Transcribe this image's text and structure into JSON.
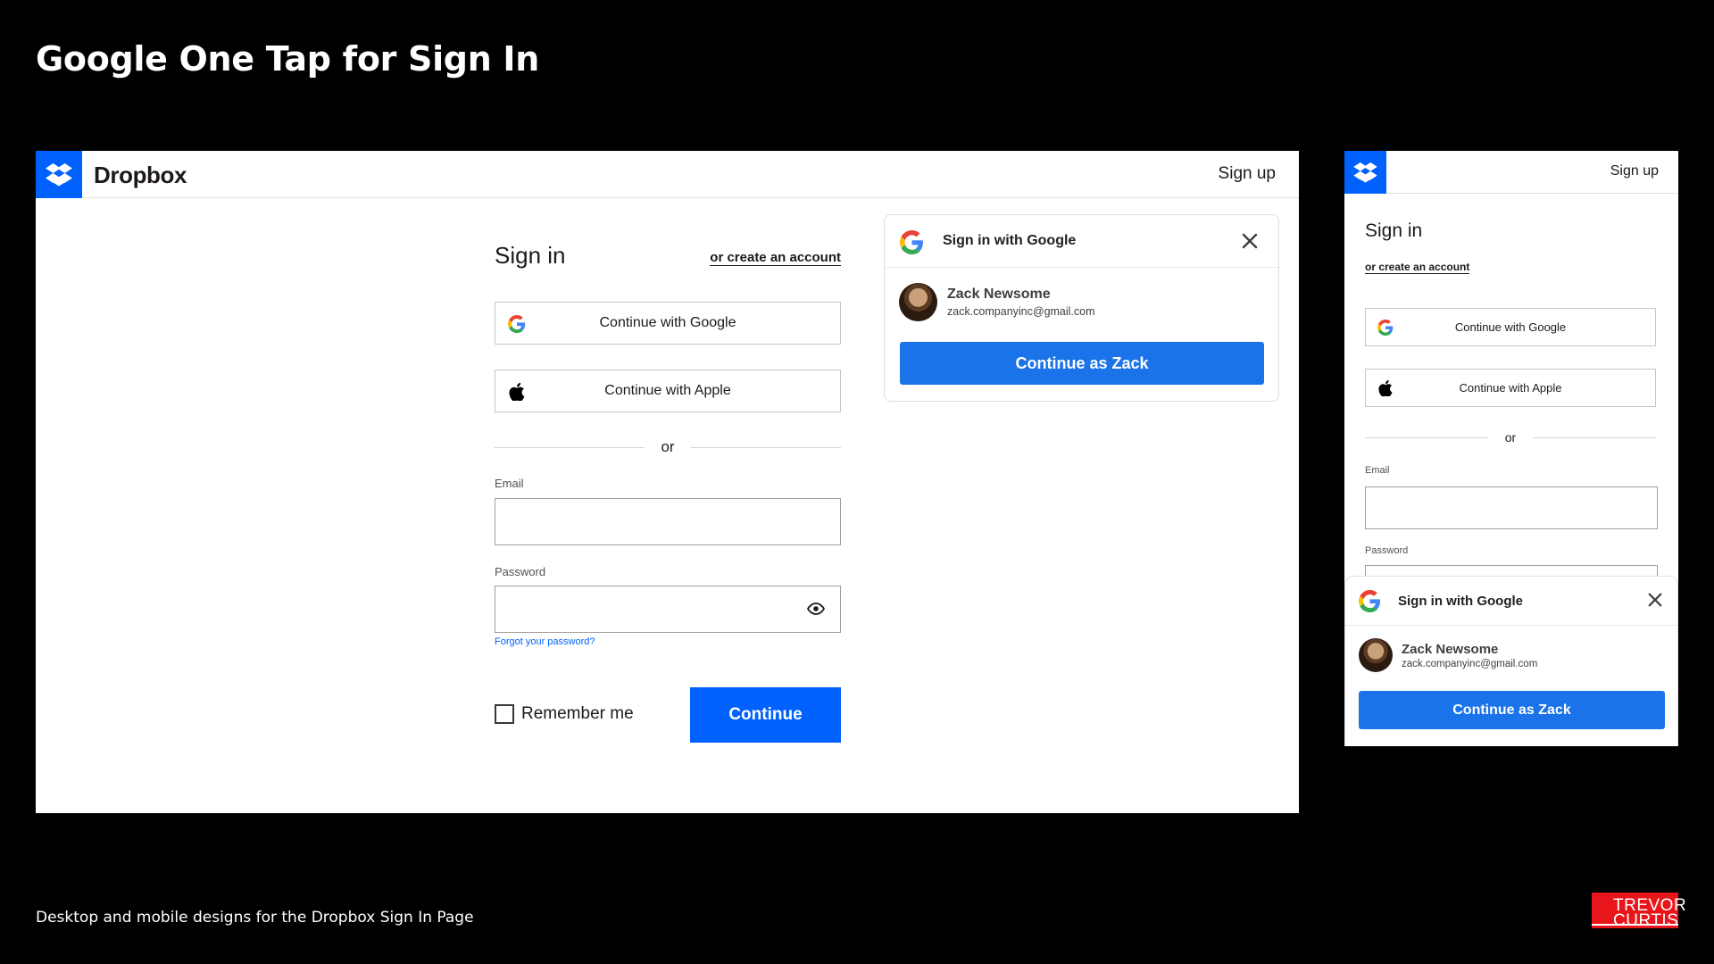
{
  "slide": {
    "title": "Google One Tap for Sign In",
    "caption": "Desktop and mobile designs for the Dropbox Sign In Page",
    "brand_line1": "TREVOR",
    "brand_line2": "CURTIS",
    "brand_color": "#e8161b"
  },
  "desktop": {
    "brand_name": "Dropbox",
    "signup_link": "Sign up",
    "form": {
      "title": "Sign in",
      "create_account": "or create an account",
      "google_button": "Continue with Google",
      "apple_button": "Continue with Apple",
      "divider": "or",
      "email_label": "Email",
      "email_value": "",
      "password_label": "Password",
      "password_value": "",
      "forgot": "Forgot your password?",
      "remember": "Remember me",
      "continue": "Continue"
    },
    "one_tap": {
      "header": "Sign in with Google",
      "account_name": "Zack Newsome",
      "account_email": "zack.companyinc@gmail.com",
      "button": "Continue as Zack"
    }
  },
  "mobile": {
    "signup_link": "Sign up",
    "title": "Sign in",
    "create_account": "or create an account",
    "google_button": "Continue with Google",
    "apple_button": "Continue with Apple",
    "divider": "or",
    "email_label": "Email",
    "password_label": "Password",
    "one_tap": {
      "header": "Sign in with Google",
      "account_name": "Zack Newsome",
      "account_email": "zack.companyinc@gmail.com",
      "button": "Continue as Zack"
    }
  },
  "colors": {
    "dropbox_blue": "#0061fe",
    "google_blue": "#1a73e8"
  },
  "icons": [
    "dropbox-logo-icon",
    "google-g-icon",
    "apple-icon",
    "eye-icon",
    "close-icon",
    "avatar"
  ]
}
